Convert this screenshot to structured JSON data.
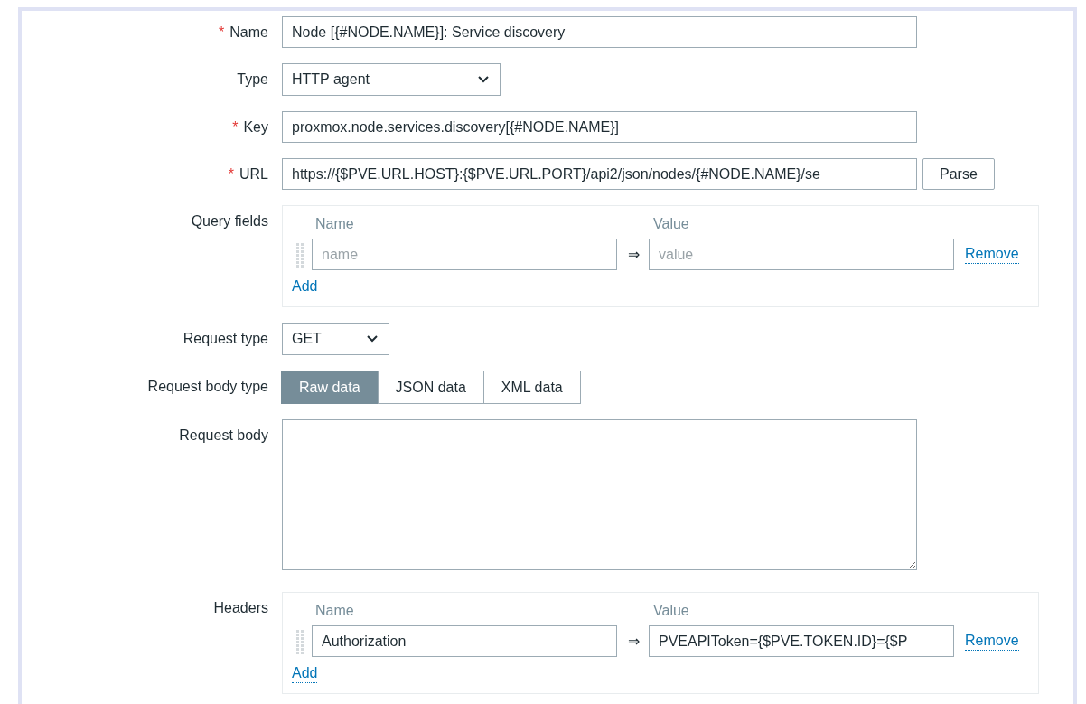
{
  "required_mark": "*",
  "fields": [
    {
      "kind": "text",
      "label": "Name",
      "required": true,
      "value": "Node [{#NODE.NAME}]: Service discovery"
    },
    {
      "kind": "select",
      "label": "Type",
      "required": false,
      "value": "HTTP agent"
    },
    {
      "kind": "text",
      "label": "Key",
      "required": true,
      "value": "proxmox.node.services.discovery[{#NODE.NAME}]"
    },
    {
      "kind": "url",
      "label": "URL",
      "required": true,
      "value": "https://{$PVE.URL.HOST}:{$PVE.URL.PORT}/api2/json/nodes/{#NODE.NAME}/se",
      "button": "Parse"
    },
    {
      "kind": "pairs",
      "label": "Query fields",
      "required": false,
      "name_header": "Name",
      "value_header": "Value",
      "rows": [
        {
          "name": {
            "placeholder": "name"
          },
          "arrow": "⇒",
          "value": {
            "placeholder": "value"
          },
          "remove": "Remove"
        }
      ],
      "add": "Add"
    },
    {
      "kind": "select",
      "label": "Request type",
      "required": false,
      "value": "GET"
    },
    {
      "kind": "segmented",
      "label": "Request body type",
      "required": false,
      "options": [
        {
          "label": "Raw data",
          "selected": true
        },
        {
          "label": "JSON data",
          "selected": false
        },
        {
          "label": "XML data",
          "selected": false
        }
      ]
    },
    {
      "kind": "textarea",
      "label": "Request body",
      "required": false
    },
    {
      "kind": "pairs",
      "label": "Headers",
      "required": false,
      "name_header": "Name",
      "value_header": "Value",
      "rows": [
        {
          "name": {
            "value": "Authorization"
          },
          "arrow": "⇒",
          "value": {
            "value": "PVEAPIToken={$PVE.TOKEN.ID}={$P"
          },
          "remove": "Remove"
        }
      ],
      "add": "Add"
    }
  ]
}
